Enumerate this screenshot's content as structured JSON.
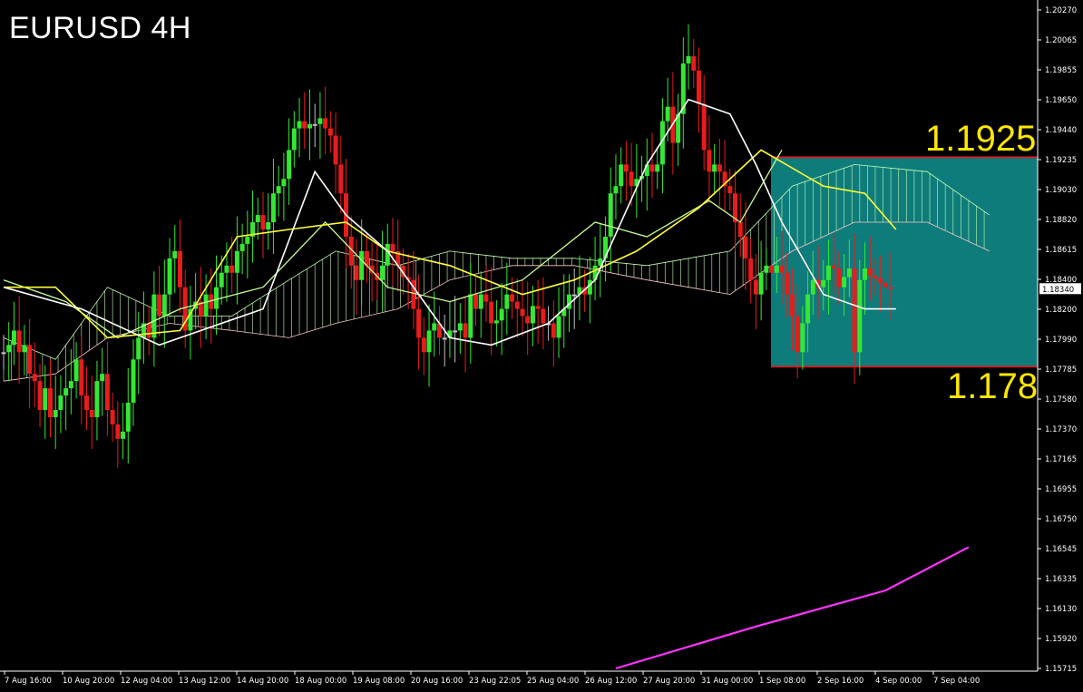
{
  "chart_title": "EURUSD 4H",
  "levels": {
    "upper_label": "1.1925",
    "lower_label": "1.178"
  },
  "current_price_label": "1.18340",
  "colors": {
    "background": "#000000",
    "up": "#33e833",
    "down": "#e81c1c",
    "doji": "#c2c2c2",
    "tenkan": "#ffffff",
    "kijun": "#ffff33",
    "chikou": "#c8ff96",
    "cloud_bull": "#c8ffb4",
    "cloud_bear": "#ffc8c8",
    "zone_fill": "#0e7c7b",
    "zone_border": "#cc2222",
    "sma": "#ff33ff",
    "axis": "#ffffff"
  },
  "chart_data": {
    "type": "candlestick",
    "title": "EURUSD 4H",
    "ylim": [
      1.1571,
      1.2027
    ],
    "yticks": [
      "1.20270",
      "1.20065",
      "1.19855",
      "1.19650",
      "1.19440",
      "1.19235",
      "1.19030",
      "1.18820",
      "1.18615",
      "1.18400",
      "1.18200",
      "1.17990",
      "1.17785",
      "1.17580",
      "1.17370",
      "1.17165",
      "1.16955",
      "1.16750",
      "1.16545",
      "1.16335",
      "1.16130",
      "1.15920",
      "1.15715"
    ],
    "xticks": [
      "7 Aug 16:00",
      "10 Aug 20:00",
      "12 Aug 04:00",
      "13 Aug 12:00",
      "14 Aug 20:00",
      "18 Aug 00:00",
      "19 Aug 08:00",
      "20 Aug 16:00",
      "23 Aug 22:05",
      "25 Aug 04:00",
      "26 Aug 12:00",
      "27 Aug 20:00",
      "31 Aug 00:00",
      "1 Sep 08:00",
      "2 Sep 16:00",
      "4 Sep 00:00",
      "7 Sep 04:00"
    ],
    "zone": {
      "top": 1.1925,
      "bottom": 1.178
    },
    "last_price": 1.1834,
    "close": [
      1.179,
      1.1795,
      1.1805,
      1.179,
      1.1795,
      1.1775,
      1.177,
      1.175,
      1.1765,
      1.1745,
      1.175,
      1.176,
      1.1765,
      1.177,
      1.1785,
      1.176,
      1.175,
      1.1745,
      1.177,
      1.1775,
      1.175,
      1.174,
      1.173,
      1.1735,
      1.1755,
      1.1785,
      1.18,
      1.181,
      1.18,
      1.183,
      1.1815,
      1.183,
      1.1855,
      1.186,
      1.1835,
      1.1805,
      1.182,
      1.1825,
      1.1815,
      1.183,
      1.182,
      1.1835,
      1.1845,
      1.185,
      1.1845,
      1.186,
      1.1865,
      1.187,
      1.188,
      1.1885,
      1.1875,
      1.188,
      1.19,
      1.1905,
      1.191,
      1.193,
      1.1945,
      1.195,
      1.1945,
      1.1948,
      1.1948,
      1.1952,
      1.1945,
      1.194,
      1.192,
      1.19,
      1.187,
      1.185,
      1.184,
      1.186,
      1.185,
      1.1845,
      1.184,
      1.185,
      1.1865,
      1.186,
      1.185,
      1.1842,
      1.184,
      1.182,
      1.18,
      1.179,
      1.1805,
      1.181,
      1.18,
      1.18,
      1.1805,
      1.1805,
      1.181,
      1.18,
      1.183,
      1.182,
      1.183,
      1.1825,
      1.181,
      1.1812,
      1.182,
      1.183,
      1.1825,
      1.182,
      1.1815,
      1.181,
      1.1822,
      1.182,
      1.181,
      1.181,
      1.18,
      1.1815,
      1.182,
      1.183,
      1.183,
      1.1835,
      1.183,
      1.184,
      1.185,
      1.1855,
      1.187,
      1.19,
      1.1905,
      1.192,
      1.1915,
      1.1905,
      1.191,
      1.1912,
      1.192,
      1.1915,
      1.192,
      1.195,
      1.196,
      1.1935,
      1.1955,
      1.199,
      1.1995,
      1.1985,
      1.1962,
      1.193,
      1.1915,
      1.192,
      1.1915,
      1.1905,
      1.19,
      1.188,
      1.187,
      1.1855,
      1.184,
      1.183,
      1.1845,
      1.185,
      1.1845,
      1.185,
      1.1845,
      1.183,
      1.1815,
      1.179,
      1.181,
      1.183,
      1.184,
      1.1835,
      1.184,
      1.185,
      1.1848,
      1.1835,
      1.1842,
      1.1848,
      1.179,
      1.184,
      1.1848,
      1.1843,
      1.1841,
      1.1838,
      1.1835,
      1.1834
    ],
    "open_offsets_note_removed": true,
    "tenkan": [
      [
        0,
        1.1835
      ],
      [
        15,
        1.182
      ],
      [
        30,
        1.1795
      ],
      [
        50,
        1.182
      ],
      [
        60,
        1.1915
      ],
      [
        66,
        1.1885
      ],
      [
        74,
        1.186
      ],
      [
        86,
        1.18
      ],
      [
        94,
        1.1795
      ],
      [
        105,
        1.181
      ],
      [
        114,
        1.184
      ],
      [
        124,
        1.192
      ],
      [
        132,
        1.1965
      ],
      [
        140,
        1.1955
      ],
      [
        145,
        1.192
      ],
      [
        150,
        1.188
      ],
      [
        158,
        1.183
      ],
      [
        166,
        1.182
      ],
      [
        172,
        1.182
      ]
    ],
    "kijun": [
      [
        0,
        1.1835
      ],
      [
        10,
        1.1835
      ],
      [
        20,
        1.18
      ],
      [
        34,
        1.1805
      ],
      [
        45,
        1.187
      ],
      [
        55,
        1.1875
      ],
      [
        66,
        1.188
      ],
      [
        74,
        1.186
      ],
      [
        86,
        1.185
      ],
      [
        100,
        1.183
      ],
      [
        110,
        1.184
      ],
      [
        122,
        1.186
      ],
      [
        134,
        1.189
      ],
      [
        146,
        1.193
      ],
      [
        158,
        1.1905
      ],
      [
        166,
        1.19
      ],
      [
        172,
        1.1875
      ]
    ],
    "chikou": [
      [
        0,
        1.184
      ],
      [
        12,
        1.1825
      ],
      [
        22,
        1.18
      ],
      [
        34,
        1.182
      ],
      [
        50,
        1.1835
      ],
      [
        62,
        1.188
      ],
      [
        74,
        1.1835
      ],
      [
        86,
        1.1825
      ],
      [
        100,
        1.184
      ],
      [
        114,
        1.188
      ],
      [
        124,
        1.187
      ],
      [
        136,
        1.1895
      ],
      [
        142,
        1.188
      ],
      [
        150,
        1.193
      ]
    ],
    "cloud_a": [
      [
        0,
        1.18
      ],
      [
        10,
        1.1785
      ],
      [
        20,
        1.1835
      ],
      [
        32,
        1.1815
      ],
      [
        44,
        1.1815
      ],
      [
        55,
        1.184
      ],
      [
        64,
        1.186
      ],
      [
        76,
        1.185
      ],
      [
        86,
        1.186
      ],
      [
        98,
        1.1855
      ],
      [
        110,
        1.1855
      ],
      [
        124,
        1.185
      ],
      [
        140,
        1.186
      ],
      [
        152,
        1.1905
      ],
      [
        164,
        1.192
      ],
      [
        178,
        1.1915
      ],
      [
        190,
        1.1885
      ]
    ],
    "cloud_b": [
      [
        0,
        1.177
      ],
      [
        10,
        1.1775
      ],
      [
        20,
        1.18
      ],
      [
        32,
        1.181
      ],
      [
        44,
        1.1805
      ],
      [
        55,
        1.18
      ],
      [
        64,
        1.181
      ],
      [
        76,
        1.182
      ],
      [
        86,
        1.184
      ],
      [
        98,
        1.185
      ],
      [
        110,
        1.185
      ],
      [
        124,
        1.184
      ],
      [
        140,
        1.183
      ],
      [
        152,
        1.186
      ],
      [
        164,
        1.188
      ],
      [
        178,
        1.188
      ],
      [
        190,
        1.186
      ]
    ],
    "sma": [
      [
        118,
        1.1571
      ],
      [
        145,
        1.16
      ],
      [
        170,
        1.1625
      ],
      [
        186,
        1.1655
      ]
    ]
  }
}
